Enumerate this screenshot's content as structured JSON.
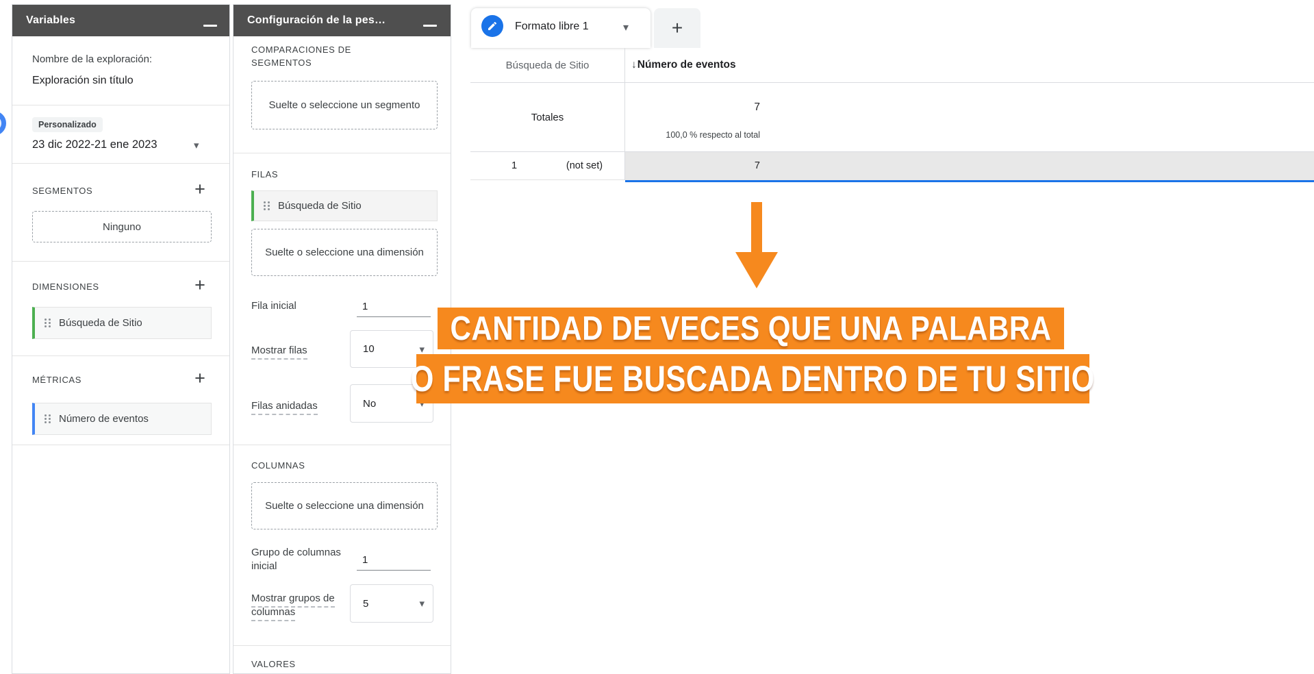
{
  "colors": {
    "panel_header_bg": "#4f4f4f",
    "accent_blue": "#1a73e8",
    "chip_green": "#4CAF50",
    "chip_blue": "#4285F4",
    "selected_row_bg": "#e8e8e8",
    "annotation_orange": "#F6891E"
  },
  "variables_panel": {
    "title": "Variables",
    "name_label": "Nombre de la exploración:",
    "name_value": "Exploración sin título",
    "date_badge": "Personalizado",
    "date_range": "23 dic 2022-21 ene 2023",
    "segments": {
      "label": "SEGMENTOS",
      "add": "+",
      "placeholder": "Ninguno"
    },
    "dimensions": {
      "label": "DIMENSIONES",
      "add": "+",
      "chip": "Búsqueda de Sitio"
    },
    "metrics": {
      "label": "MÉTRICAS",
      "add": "+",
      "chip": "Número de eventos"
    }
  },
  "config_panel": {
    "title": "Configuración de la pes…",
    "segment_comparisons": {
      "label": "COMPARACIONES DE SEGMENTOS",
      "placeholder": "Suelte o seleccione un segmento"
    },
    "rows": {
      "label": "FILAS",
      "chip": "Búsqueda de Sitio",
      "placeholder": "Suelte o seleccione una dimensión",
      "start_label": "Fila inicial",
      "start_value": "1",
      "show_label": "Mostrar filas",
      "show_value": "10",
      "nested_label": "Filas anidadas",
      "nested_value": "No"
    },
    "columns": {
      "label": "COLUMNAS",
      "placeholder": "Suelte o seleccione una dimensión",
      "start_label": "Grupo de columnas inicial",
      "start_value": "1",
      "show_label": "Mostrar grupos de columnas",
      "show_value": "5"
    },
    "values_label": "VALORES"
  },
  "main": {
    "tab": {
      "label": "Formato libre 1"
    },
    "add_tab": "+",
    "table": {
      "dimension_header": "Búsqueda de Sitio",
      "sort_icon": "↓",
      "metric_header": "Número de eventos",
      "totals_label": "Totales",
      "totals_value": "7",
      "totals_percent": "100,0 % respecto al total",
      "rows": [
        {
          "index": "1",
          "dimension": "(not set)",
          "value": "7"
        }
      ]
    },
    "annotation": {
      "line1": "CANTIDAD DE VECES QUE UNA PALABRA",
      "line2": "O FRASE FUE BUSCADA DENTRO DE TU SITIO"
    }
  }
}
